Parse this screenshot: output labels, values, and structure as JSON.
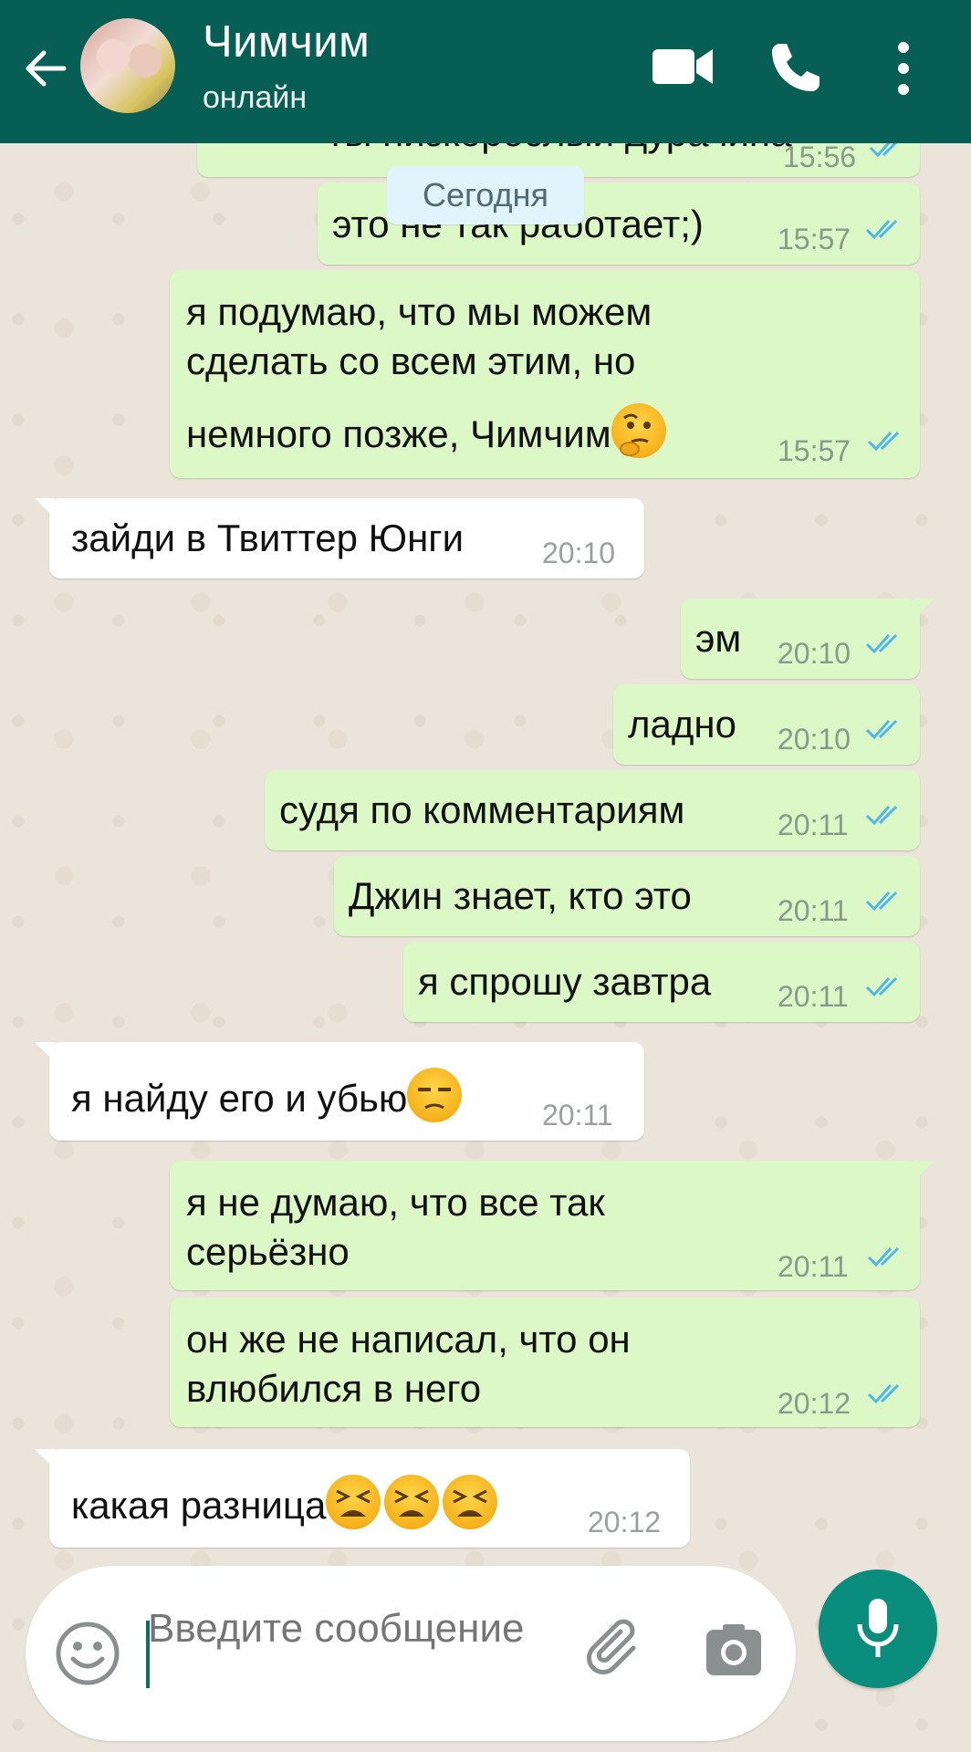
{
  "header": {
    "name": "Чимчим",
    "status": "онлайн",
    "icons": [
      "back-arrow-icon",
      "avatar",
      "video-call-icon",
      "phone-icon",
      "more-vert-icon"
    ],
    "background_color": "#075e54"
  },
  "date_chip": "Сегодня",
  "messages": [
    {
      "dir": "out",
      "text": "ты низкорослый дурачина",
      "time": "15:56",
      "status": "read"
    },
    {
      "dir": "out",
      "text": "это не так работает;)",
      "time": "15:57",
      "status": "read"
    },
    {
      "dir": "out",
      "line1": "я подумаю, что мы можем",
      "line2": "сделать со всем этим, но",
      "line3": "немного позже, Чимчим",
      "emoji": "thinking-face",
      "time": "15:57",
      "status": "read"
    },
    {
      "dir": "in",
      "text": "зайди в Твиттер Юнги",
      "time": "20:10"
    },
    {
      "dir": "out",
      "text": "эм",
      "time": "20:10",
      "status": "read"
    },
    {
      "dir": "out",
      "text": "ладно",
      "time": "20:10",
      "status": "read"
    },
    {
      "dir": "out",
      "text": "судя по комментариям",
      "time": "20:11",
      "status": "read"
    },
    {
      "dir": "out",
      "text": "Джин знает, кто это",
      "time": "20:11",
      "status": "read"
    },
    {
      "dir": "out",
      "text": "я спрошу завтра",
      "time": "20:11",
      "status": "read"
    },
    {
      "dir": "in",
      "text": "я найду его и убью",
      "emoji": "unamused-face",
      "time": "20:11"
    },
    {
      "dir": "out",
      "line1": "я не думаю, что все так",
      "line2": "серьёзно",
      "time": "20:11",
      "status": "read"
    },
    {
      "dir": "out",
      "line1": "он же не написал, что он",
      "line2": "влюбился в него",
      "time": "20:12",
      "status": "read"
    },
    {
      "dir": "in",
      "text": "какая разница",
      "emoji": "weary-face x3",
      "time": "20:12"
    }
  ],
  "input": {
    "placeholder": "Введите сообщение",
    "icons": [
      "smiley-icon",
      "attach-clip-icon",
      "camera-icon",
      "mic-icon"
    ]
  },
  "colors": {
    "outgoing_bubble": "#dcf8c6",
    "incoming_bubble": "#ffffff",
    "read_ticks": "#4fb6ec",
    "mic_button": "#0b8d7e"
  }
}
